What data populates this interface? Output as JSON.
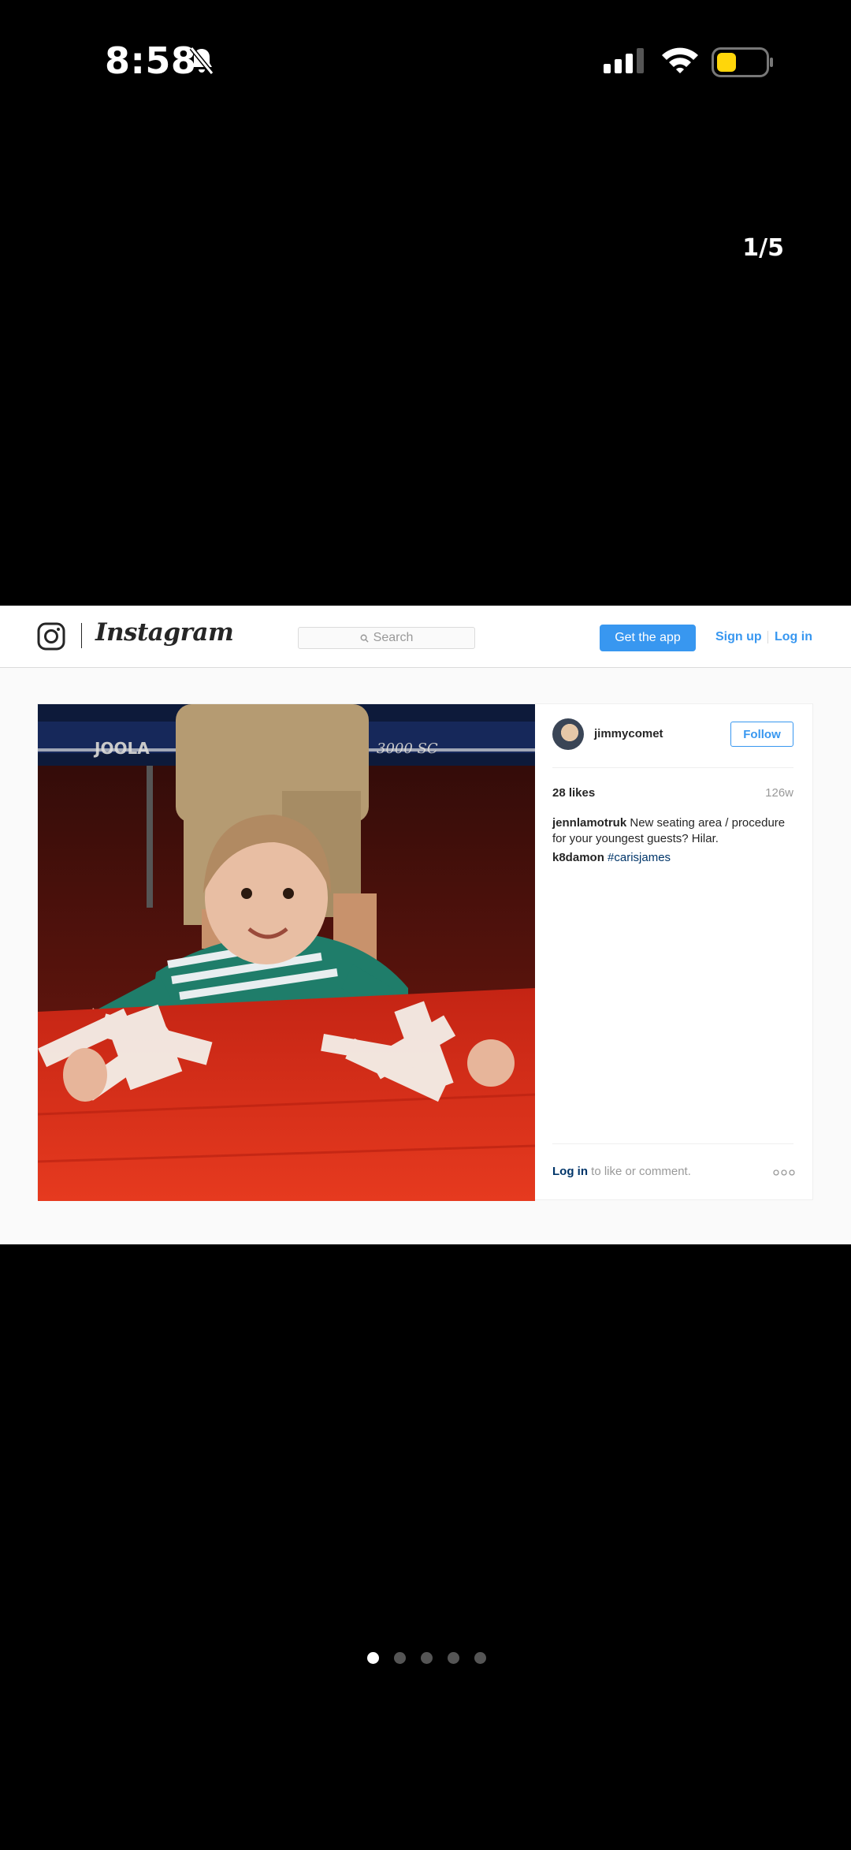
{
  "status_bar": {
    "time": "8:58",
    "icons": [
      "bell-slash-icon",
      "cellular-signal-icon",
      "wifi-icon",
      "battery-icon"
    ]
  },
  "viewer": {
    "counter": "1/5",
    "page_count": 5,
    "active_page": 1
  },
  "instagram": {
    "wordmark": "Instagram",
    "search_placeholder": "Search",
    "get_app_label": "Get the app",
    "sign_up_label": "Sign up",
    "log_in_label": "Log in",
    "post": {
      "username": "jimmycomet",
      "follow_label": "Follow",
      "likes": "28 likes",
      "age": "126w",
      "caption_user": "jennlamotruk",
      "caption_text": "New seating area / procedure for your youngest guests? Hilar.",
      "comment_user": "k8damon",
      "comment_hashtag": "#carisjames",
      "cta_link": "Log in",
      "cta_text": "to like or comment.",
      "photo_text": [
        "JOOLA",
        "3000 SC"
      ]
    }
  },
  "colors": {
    "accent": "#3897f0",
    "link": "#003569",
    "table_red": "#d82a18"
  }
}
